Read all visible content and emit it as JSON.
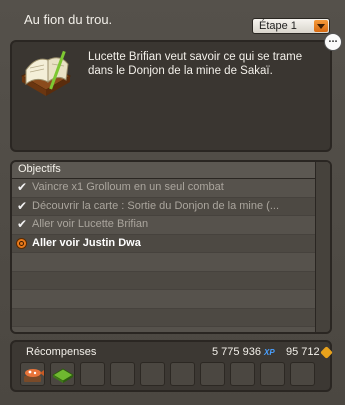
{
  "quest": {
    "title": "Au fion du trou.",
    "step": "Étape 1",
    "description": "Lucette Brifian veut savoir ce qui se trame dans le Donjon de la mine de Sakaï."
  },
  "objectives": {
    "header": "Objectifs",
    "items": [
      {
        "text": "Vaincre x1 Grolloum en un seul combat",
        "done": true
      },
      {
        "text": "Découvrir la carte : Sortie du Donjon de la mine (...",
        "done": true
      },
      {
        "text": "Aller voir Lucette Brifian",
        "done": true
      },
      {
        "text": "Aller voir Justin Dwa",
        "done": false
      }
    ]
  },
  "rewards": {
    "label": "Récompenses",
    "xp": "5 775 936",
    "kamas": "95 712",
    "xp_unit": "XP"
  },
  "colors": {
    "accent": "#e87a1c",
    "panel": "#4a4640"
  }
}
